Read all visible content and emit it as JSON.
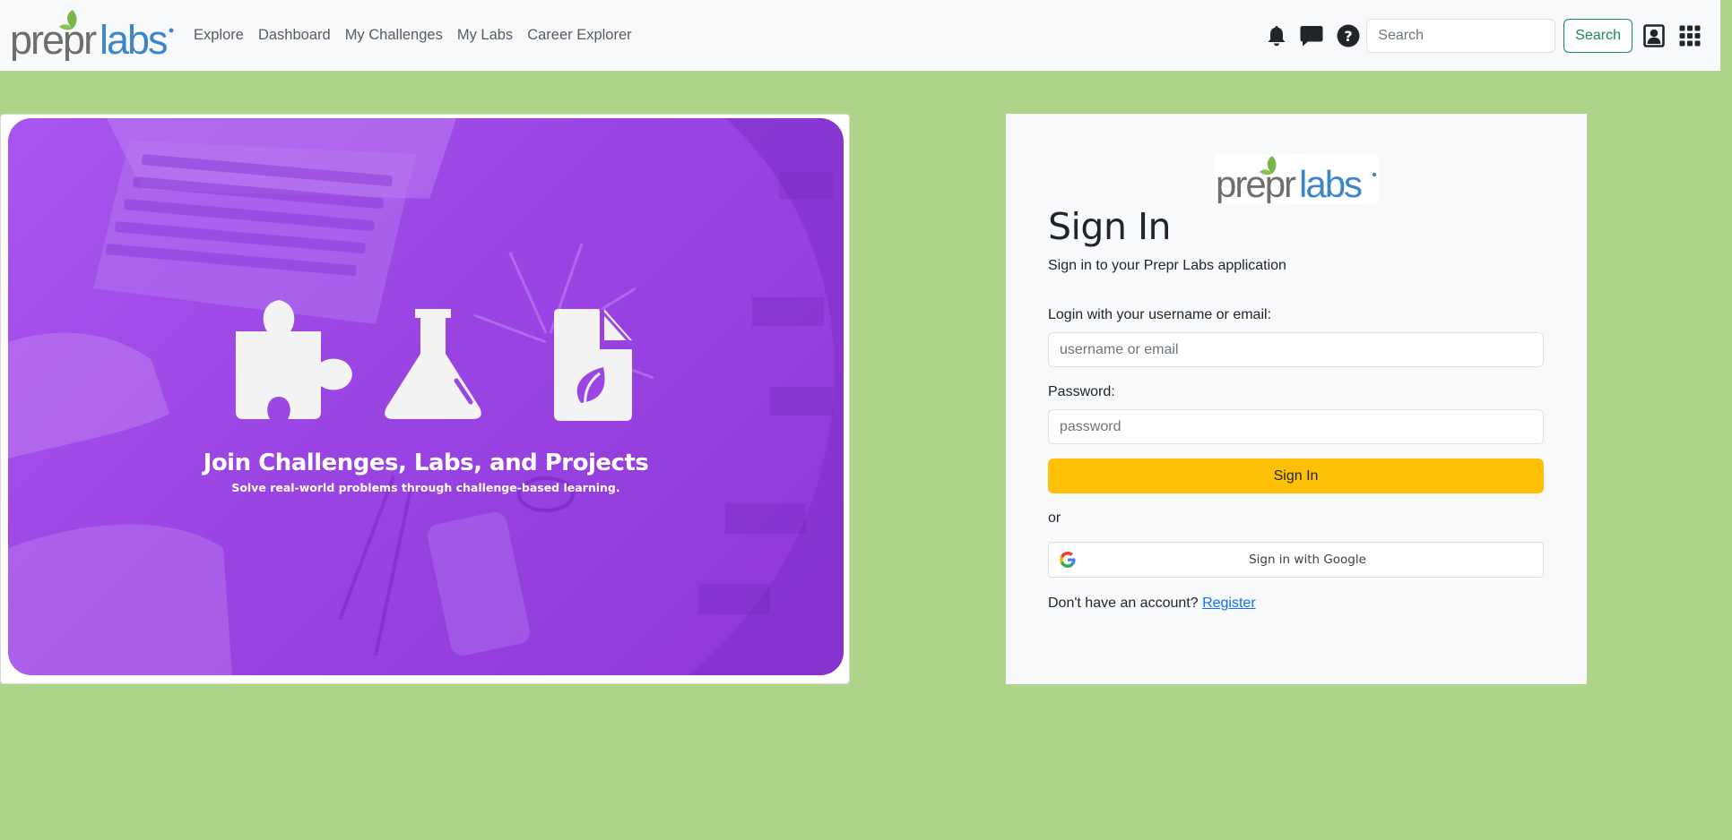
{
  "brand": {
    "logo_text_a": "prepr",
    "logo_text_b": "labs",
    "registered_mark": "®"
  },
  "colors": {
    "page_bg": "#aed48a",
    "navbar_bg": "#f8f9fa",
    "brand_gray": "#6e6e6e",
    "brand_blue": "#3c86c6",
    "brand_leaf": "#7ab648",
    "hero_purple": "#9b46e4",
    "signin_yellow": "#ffc107",
    "search_green": "#198754",
    "link_blue": "#0d6efd"
  },
  "nav": {
    "links": [
      {
        "label": "Explore"
      },
      {
        "label": "Dashboard"
      },
      {
        "label": "My Challenges"
      },
      {
        "label": "My Labs"
      },
      {
        "label": "Career Explorer"
      }
    ],
    "icons": [
      "bell-icon",
      "chat-icon",
      "help-icon",
      "user-profile-icon",
      "apps-grid-icon"
    ],
    "search": {
      "placeholder": "Search",
      "value": "",
      "button_label": "Search"
    }
  },
  "hero": {
    "title": "Join Challenges, Labs, and Projects",
    "subtitle": "Solve real-world problems through challenge-based learning.",
    "icons": [
      "puzzle-icon",
      "flask-icon",
      "document-leaf-icon"
    ]
  },
  "signin": {
    "title": "Sign In",
    "subtitle": "Sign in to your Prepr Labs application",
    "username_label": "Login with your username or email:",
    "username_placeholder": "username or email",
    "password_label": "Password:",
    "password_placeholder": "password",
    "submit_label": "Sign In",
    "or_text": "or",
    "google_label": "Sign in with Google",
    "no_account_text": "Don't have an account?",
    "register_label": "Register"
  }
}
